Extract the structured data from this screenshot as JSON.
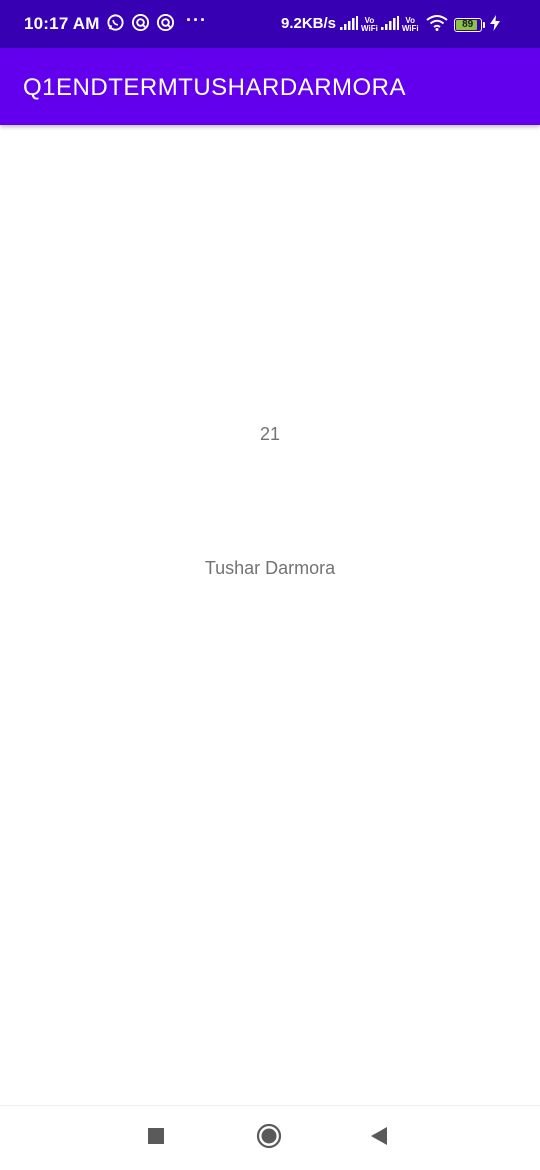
{
  "status_bar": {
    "time": "10:17 AM",
    "more_indicator": "···",
    "net_speed": "9.2KB/s",
    "vowifi_top": "Vo",
    "vowifi_bottom": "WiFi",
    "battery_level": "89",
    "colors": {
      "background": "#3700B3",
      "battery_fill": "#8BC34A"
    },
    "icons": [
      "whatsapp-icon",
      "app-notification-icon",
      "app-notification-icon",
      "signal-icon",
      "wifi-icon",
      "battery-icon",
      "charging-icon"
    ]
  },
  "app_bar": {
    "title": "Q1ENDTERMTUSHARDARMORA",
    "color": "#6200EE"
  },
  "content": {
    "number_text": "21",
    "name_text": "Tushar Darmora",
    "text_color": "#737373"
  },
  "nav_bar": {
    "icons": [
      "recents-square-icon",
      "home-circle-icon",
      "back-triangle-icon"
    ]
  }
}
